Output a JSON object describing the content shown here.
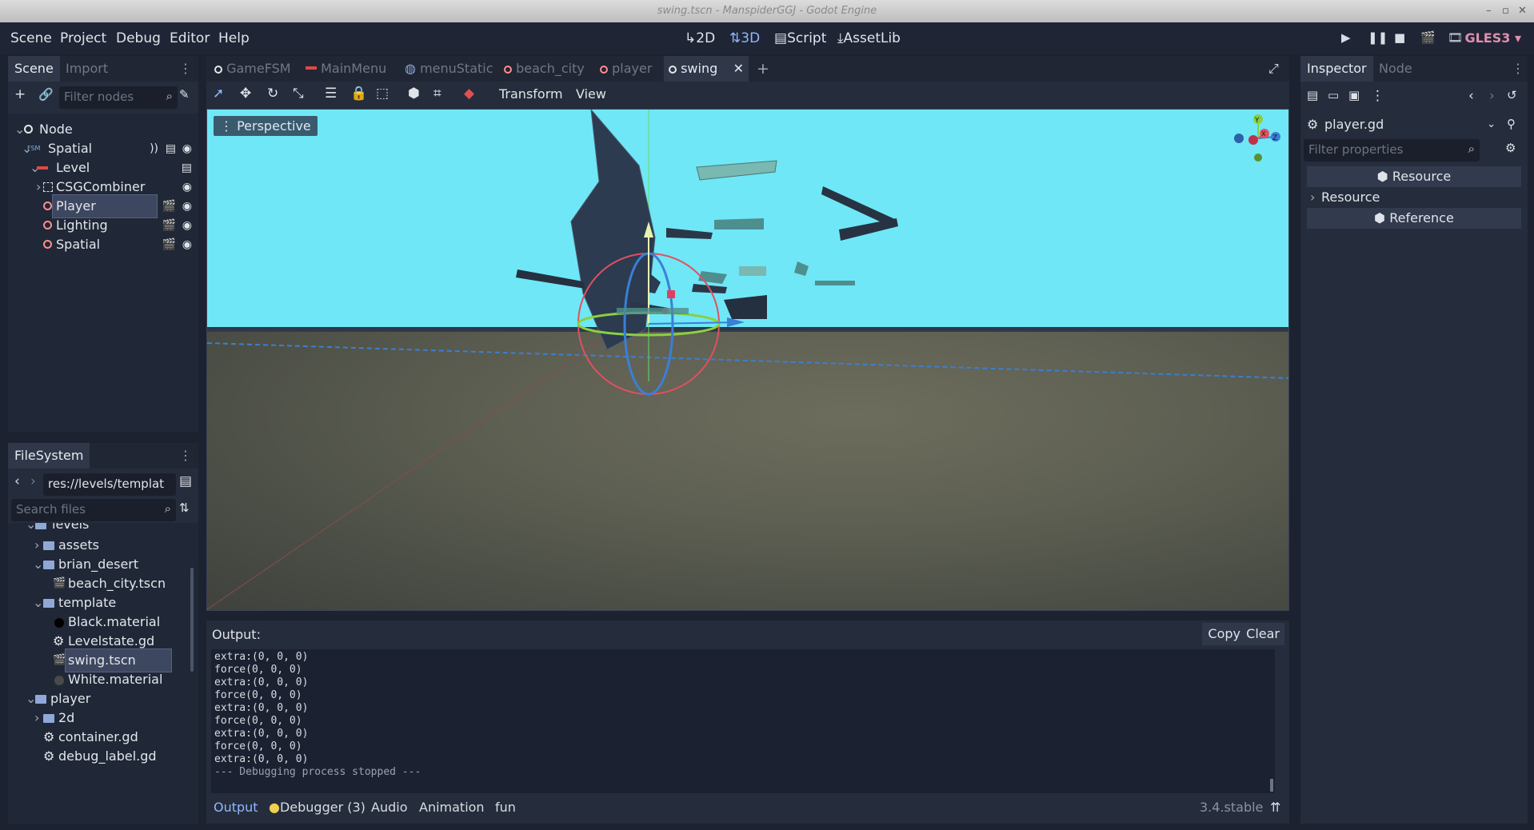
{
  "window": {
    "title": "swing.tscn - ManspiderGGJ - Godot Engine"
  },
  "menu": {
    "items": [
      "Scene",
      "Project",
      "Debug",
      "Editor",
      "Help"
    ]
  },
  "modes": {
    "two_d": "2D",
    "three_d": "3D",
    "script": "Script",
    "assetlib": "AssetLib"
  },
  "renderer": "GLES3",
  "scene_dock": {
    "tabs": [
      "Scene",
      "Import"
    ],
    "filter_placeholder": "Filter nodes",
    "tree": [
      {
        "label": "Node"
      },
      {
        "label": "Spatial"
      },
      {
        "label": "Level"
      },
      {
        "label": "CSGCombiner"
      },
      {
        "label": "Player"
      },
      {
        "label": "Lighting"
      },
      {
        "label": "Spatial"
      }
    ]
  },
  "filesystem": {
    "tab": "FileSystem",
    "path": "res://levels/templat",
    "search_placeholder": "Search files",
    "items": [
      {
        "label": "levels"
      },
      {
        "label": "assets"
      },
      {
        "label": "brian_desert"
      },
      {
        "label": "beach_city.tscn"
      },
      {
        "label": "template"
      },
      {
        "label": "Black.material"
      },
      {
        "label": "Levelstate.gd"
      },
      {
        "label": "swing.tscn"
      },
      {
        "label": "White.material"
      },
      {
        "label": "player"
      },
      {
        "label": "2d"
      },
      {
        "label": "container.gd"
      },
      {
        "label": "debug_label.gd"
      }
    ]
  },
  "editor_tabs": [
    "GameFSM",
    "MainMenu",
    "menuStatic",
    "beach_city",
    "player",
    "swing"
  ],
  "viewport_toolbar": {
    "transform": "Transform",
    "view": "View"
  },
  "viewport": {
    "label": "Perspective",
    "gizmo_x": "X",
    "gizmo_y": "Y",
    "gizmo_z": "Z"
  },
  "output": {
    "title": "Output:",
    "copy": "Copy",
    "clear": "Clear",
    "lines": [
      "extra:(0, 0, 0)",
      "force(0, 0, 0)",
      "extra:(0, 0, 0)",
      "force(0, 0, 0)",
      "extra:(0, 0, 0)",
      "force(0, 0, 0)",
      "extra:(0, 0, 0)",
      "force(0, 0, 0)",
      "extra:(0, 0, 0)",
      "--- Debugging process stopped ---"
    ]
  },
  "bottom_tabs": {
    "output": "Output",
    "debugger": "Debugger (3)",
    "audio": "Audio",
    "animation": "Animation",
    "fun": "fun"
  },
  "version": "3.4.stable",
  "inspector": {
    "tabs": [
      "Inspector",
      "Node"
    ],
    "object": "player.gd",
    "filter_placeholder": "Filter properties",
    "section1": "Resource",
    "group": "Resource",
    "section2": "Reference"
  },
  "colors": {
    "accent": "#8fb8ff",
    "sky": "#6fe7f6",
    "gles": "#e08fb0"
  }
}
